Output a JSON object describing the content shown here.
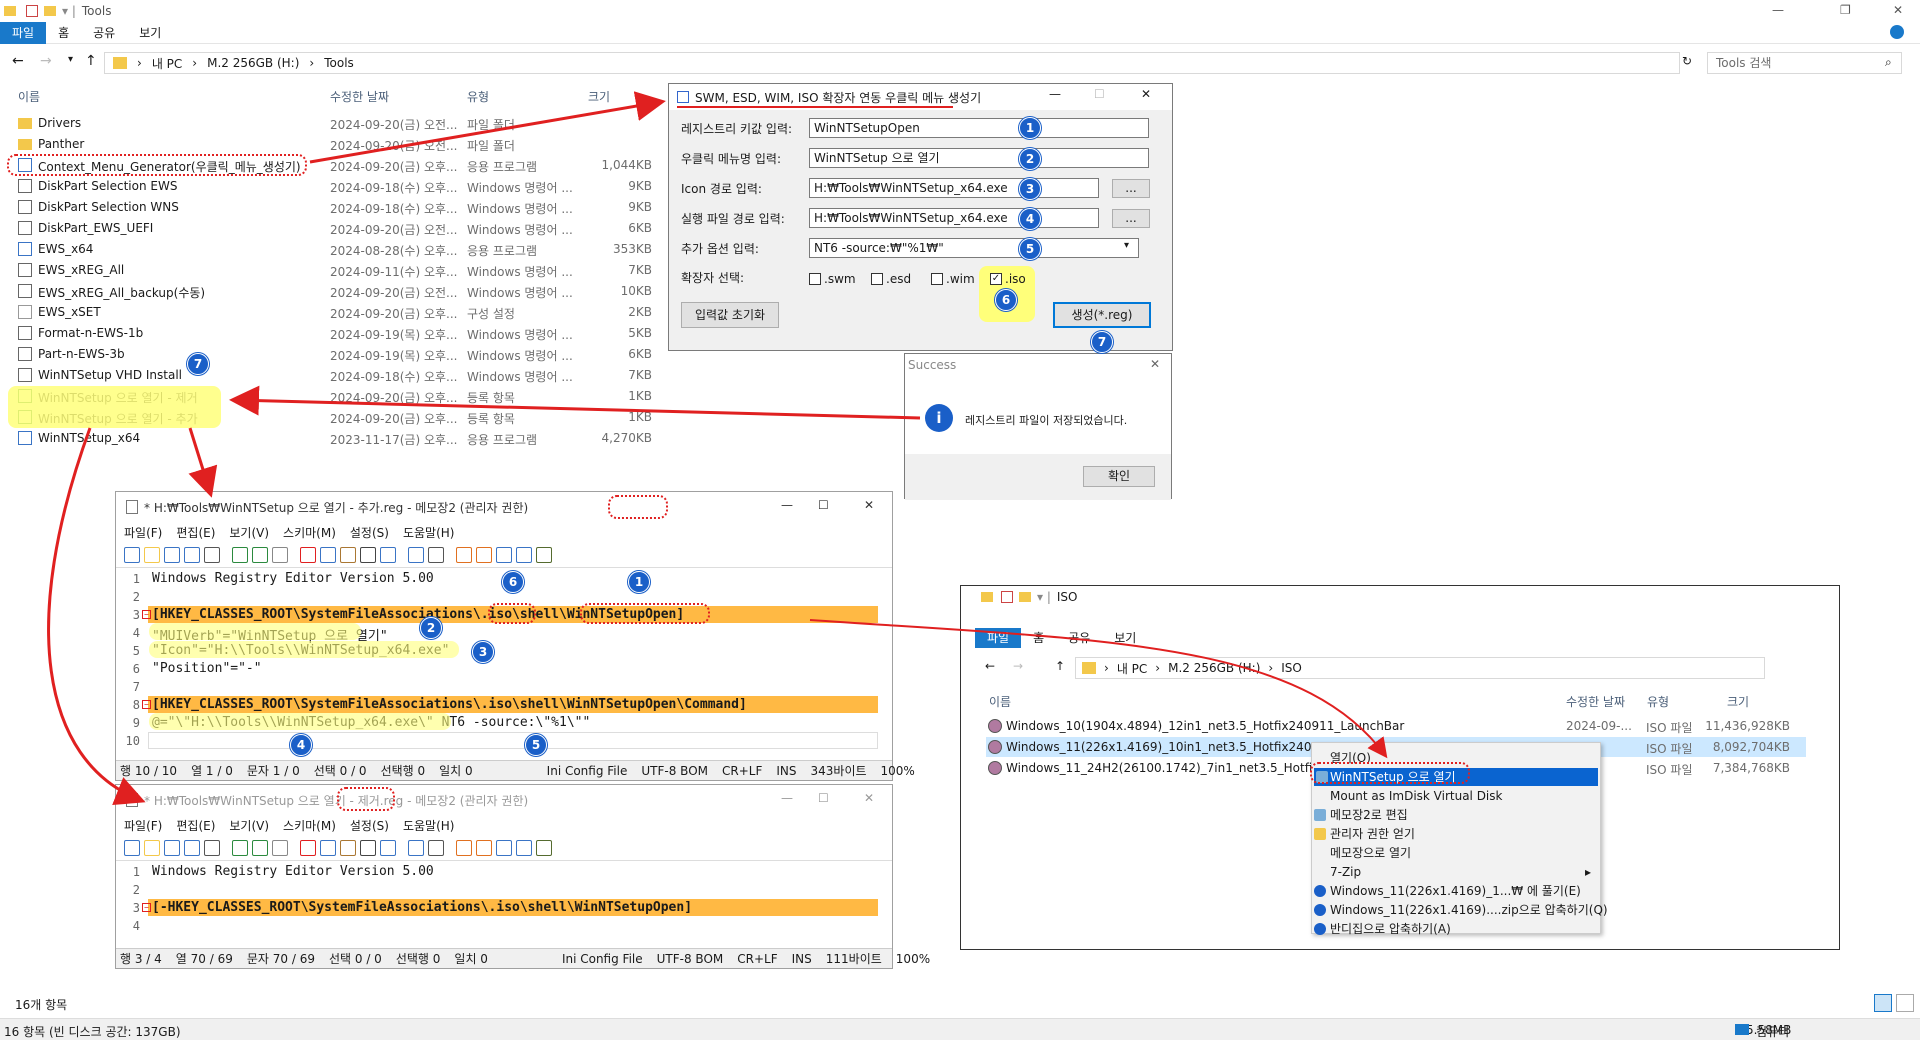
{
  "explorer": {
    "title": "Tools",
    "ribbon_tabs": [
      "파일",
      "홈",
      "공유",
      "보기"
    ],
    "breadcrumb": [
      "내 PC",
      "M.2 256GB (H:)",
      "Tools"
    ],
    "search_placeholder": "Tools 검색",
    "columns": [
      "이름",
      "수정한 날짜",
      "유형",
      "크기"
    ],
    "files": [
      {
        "name": "Drivers",
        "date": "2024-09-20(금) 오전...",
        "type": "파일 폴더",
        "size": "",
        "icon": "folder-icon"
      },
      {
        "name": "Panther",
        "date": "2024-09-20(금) 오전...",
        "type": "파일 폴더",
        "size": "",
        "icon": "folder-icon"
      },
      {
        "name": "Context_Menu_Generator(우클릭_메뉴_생성기)",
        "date": "2024-09-20(금) 오후...",
        "type": "응용 프로그램",
        "size": "1,044KB",
        "icon": "app-icon"
      },
      {
        "name": "DiskPart Selection EWS",
        "date": "2024-09-18(수) 오후...",
        "type": "Windows 명령어 ...",
        "size": "9KB",
        "icon": "cmd-icon"
      },
      {
        "name": "DiskPart Selection WNS",
        "date": "2024-09-18(수) 오후...",
        "type": "Windows 명령어 ...",
        "size": "9KB",
        "icon": "cmd-icon"
      },
      {
        "name": "DiskPart_EWS_UEFI",
        "date": "2024-09-20(금) 오전...",
        "type": "Windows 명령어 ...",
        "size": "6KB",
        "icon": "cmd-icon"
      },
      {
        "name": "EWS_x64",
        "date": "2024-08-28(수) 오후...",
        "type": "응용 프로그램",
        "size": "353KB",
        "icon": "app-icon"
      },
      {
        "name": "EWS_xREG_All",
        "date": "2024-09-11(수) 오후...",
        "type": "Windows 명령어 ...",
        "size": "7KB",
        "icon": "cmd-icon"
      },
      {
        "name": "EWS_xREG_All_backup(수동)",
        "date": "2024-09-20(금) 오전...",
        "type": "Windows 명령어 ...",
        "size": "10KB",
        "icon": "cmd-icon"
      },
      {
        "name": "EWS_xSET",
        "date": "2024-09-20(금) 오후...",
        "type": "구성 설정",
        "size": "2KB",
        "icon": "settings-file-icon"
      },
      {
        "name": "Format-n-EWS-1b",
        "date": "2024-09-19(목) 오후...",
        "type": "Windows 명령어 ...",
        "size": "5KB",
        "icon": "cmd-icon"
      },
      {
        "name": "Part-n-EWS-3b",
        "date": "2024-09-19(목) 오후...",
        "type": "Windows 명령어 ...",
        "size": "6KB",
        "icon": "cmd-icon"
      },
      {
        "name": "WinNTSetup VHD Install",
        "date": "2024-09-18(수) 오후...",
        "type": "Windows 명령어 ...",
        "size": "7KB",
        "icon": "cmd-icon"
      },
      {
        "name": "WinNTSetup 으로 열기 - 제거",
        "date": "2024-09-20(금) 오후...",
        "type": "등록 항목",
        "size": "1KB",
        "icon": "reg-icon"
      },
      {
        "name": "WinNTSetup 으로 열기 - 추가",
        "date": "2024-09-20(금) 오후...",
        "type": "등록 항목",
        "size": "1KB",
        "icon": "reg-icon"
      },
      {
        "name": "WinNTSetup_x64",
        "date": "2023-11-17(금) 오후...",
        "type": "응용 프로그램",
        "size": "4,270KB",
        "icon": "app-icon"
      }
    ],
    "item_count": "16개 항목",
    "status_left": "16 항목 (빈 디스크 공간: 137GB)",
    "status_size": "5.58MB",
    "status_computer": "컴퓨터"
  },
  "generator": {
    "title": "SWM, ESD, WIM, ISO 확장자 연동 우클릭 메뉴 생성기",
    "labels": {
      "reg_key": "레지스트리 키값 입력:",
      "menu_name": "우클릭 메뉴명 입력:",
      "icon_path": "Icon 경로 입력:",
      "exe_path": "실행 파일 경로 입력:",
      "extra": "추가 옵션 입력:",
      "ext": "확장자 선택:"
    },
    "values": {
      "reg_key": "WinNTSetupOpen",
      "menu_name": "WinNTSetup 으로 열기",
      "icon_path": "H:₩Tools₩WinNTSetup_x64.exe",
      "exe_path": "H:₩Tools₩WinNTSetup_x64.exe",
      "extra": "NT6 -source:₩\"%1₩\""
    },
    "browse": "...",
    "checkboxes": [
      {
        "label": ".swm",
        "checked": false
      },
      {
        "label": ".esd",
        "checked": false
      },
      {
        "label": ".wim",
        "checked": false
      },
      {
        "label": ".iso",
        "checked": true
      }
    ],
    "reset_button": "입력값 초기화",
    "create_button": "생성(*.reg)",
    "check_mark": "✓"
  },
  "success": {
    "title": "Success",
    "message": "레지스트리 파일이 저장되었습니다.",
    "ok": "확인",
    "info_glyph": "i"
  },
  "notepad_add": {
    "title": "* H:₩Tools₩WinNTSetup 으로 열기 - 추가.reg - 메모장2 (관리자 권한)",
    "menu": [
      "파일(F)",
      "편집(E)",
      "보기(V)",
      "스키마(M)",
      "설정(S)",
      "도움말(H)"
    ],
    "lines": [
      "Windows Registry Editor Version 5.00",
      "",
      "[HKEY_CLASSES_ROOT\\SystemFileAssociations\\.iso\\shell\\WinNTSetupOpen]",
      "\"MUIVerb\"=\"WinNTSetup 으로 열기\"",
      "\"Icon\"=\"H:\\\\Tools\\\\WinNTSetup_x64.exe\"",
      "\"Position\"=\"-\"",
      "",
      "[HKEY_CLASSES_ROOT\\SystemFileAssociations\\.iso\\shell\\WinNTSetupOpen\\Command]",
      "@=\"\\\"H:\\\\Tools\\\\WinNTSetup_x64.exe\\\" NT6 -source:\\\"%1\\\"\"",
      ""
    ],
    "status": [
      "행 10 / 10",
      "열 1 / 0",
      "문자 1 / 0",
      "선택 0 / 0",
      "선택행 0",
      "일치 0",
      "Ini Config File",
      "UTF-8 BOM",
      "CR+LF",
      "INS",
      "343바이트",
      "100%"
    ]
  },
  "notepad_remove": {
    "title": "* H:₩Tools₩WinNTSetup 으로 열기 - 제거.reg - 메모장2 (관리자 권한)",
    "menu": [
      "파일(F)",
      "편집(E)",
      "보기(V)",
      "스키마(M)",
      "설정(S)",
      "도움말(H)"
    ],
    "lines": [
      "Windows Registry Editor Version 5.00",
      "",
      "[-HKEY_CLASSES_ROOT\\SystemFileAssociations\\.iso\\shell\\WinNTSetupOpen]",
      ""
    ],
    "status": [
      "행 3 / 4",
      "열 70 / 69",
      "문자 70 / 69",
      "선택 0 / 0",
      "선택행 0",
      "일치 0",
      "Ini Config File",
      "UTF-8 BOM",
      "CR+LF",
      "INS",
      "111바이트",
      "100%"
    ]
  },
  "iso_explorer": {
    "title": "ISO",
    "ribbon_tabs": [
      "파일",
      "홈",
      "공유",
      "보기"
    ],
    "breadcrumb": [
      "내 PC",
      "M.2 256GB (H:)",
      "ISO"
    ],
    "columns": [
      "이름",
      "수정한 날짜",
      "유형",
      "크기"
    ],
    "files": [
      {
        "name": "Windows_10(1904x.4894)_12in1_net3.5_Hotfix240911_LaunchBar",
        "date": "2024-09-...",
        "type": "ISO 파일",
        "size": "11,436,928KB"
      },
      {
        "name": "Windows_11(226x1.4169)_10in1_net3.5_Hotfix240911",
        "date": "",
        "type": "ISO 파일",
        "size": "8,092,704KB"
      },
      {
        "name": "Windows_11_24H2(26100.1742)_7in1_net3.5_Hotfix24",
        "date": "",
        "type": "ISO 파일",
        "size": "7,384,768KB"
      }
    ],
    "context_menu": [
      "열기(O)",
      "WinNTSetup 으로 열기",
      "Mount as ImDisk Virtual Disk",
      "메모장2로 편집",
      "관리자 권한 얻기",
      "메모장으로 열기",
      "7-Zip",
      "Windows_11(226x1.4169)_1...₩ 에 풀기(E)",
      "Windows_11(226x1.4169)....zip으로 압축하기(Q)",
      "반디집으로 압축하기(A)"
    ],
    "submenu_arrow": "▸"
  },
  "markers": [
    "1",
    "2",
    "3",
    "4",
    "5",
    "6",
    "7"
  ],
  "colors": {
    "accent": "#1979ca",
    "highlight": "#ffb944",
    "callout_yellow": "#ffff7a",
    "annotation_red": "#e02020",
    "badge_blue": "#1a5fc8"
  }
}
